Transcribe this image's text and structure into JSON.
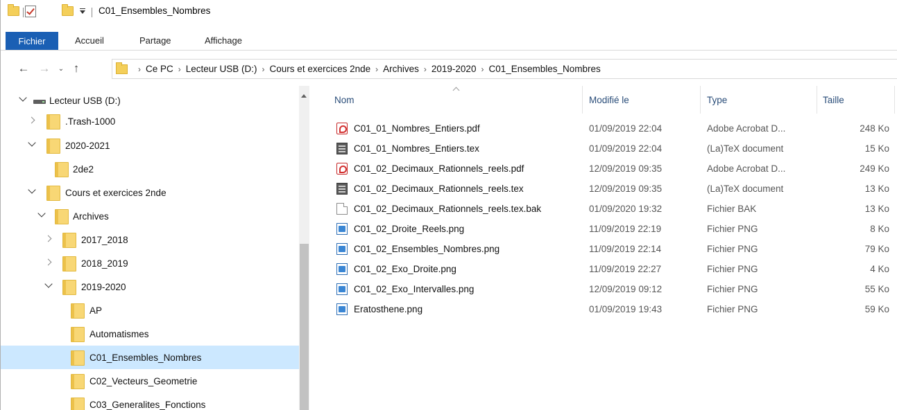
{
  "window": {
    "title": "C01_Ensembles_Nombres"
  },
  "ribbon": {
    "file_tab": "Fichier",
    "tabs": [
      "Accueil",
      "Partage",
      "Affichage"
    ]
  },
  "address": {
    "crumbs": [
      "Ce PC",
      "Lecteur USB (D:)",
      "Cours et exercices 2nde",
      "Archives",
      "2019-2020",
      "C01_Ensembles_Nombres"
    ]
  },
  "navpane": {
    "items": [
      {
        "label": "Lecteur USB (D:)",
        "icon": "usb-drive-icon",
        "state": "expanded"
      },
      {
        "label": ".Trash-1000",
        "icon": "folder-icon",
        "state": "collapsed"
      },
      {
        "label": "2020-2021",
        "icon": "folder-icon",
        "state": "expanded"
      },
      {
        "label": "2de2",
        "icon": "folder-icon",
        "state": "leaf"
      },
      {
        "label": "Cours et exercices 2nde",
        "icon": "folder-icon",
        "state": "expanded"
      },
      {
        "label": "Archives",
        "icon": "folder-icon",
        "state": "expanded"
      },
      {
        "label": "2017_2018",
        "icon": "folder-icon",
        "state": "collapsed"
      },
      {
        "label": "2018_2019",
        "icon": "folder-icon",
        "state": "collapsed"
      },
      {
        "label": "2019-2020",
        "icon": "folder-icon",
        "state": "expanded"
      },
      {
        "label": "AP",
        "icon": "folder-icon",
        "state": "leaf"
      },
      {
        "label": "Automatismes",
        "icon": "folder-icon",
        "state": "leaf"
      },
      {
        "label": "C01_Ensembles_Nombres",
        "icon": "folder-icon",
        "state": "leaf",
        "selected": true
      },
      {
        "label": "C02_Vecteurs_Geometrie",
        "icon": "folder-icon",
        "state": "leaf"
      },
      {
        "label": "C03_Generalites_Fonctions",
        "icon": "folder-icon",
        "state": "leaf"
      }
    ]
  },
  "filelist": {
    "columns": {
      "name": "Nom",
      "modified": "Modifié le",
      "type": "Type",
      "size": "Taille"
    },
    "files": [
      {
        "name": "C01_01_Nombres_Entiers.pdf",
        "modified": "01/09/2019 22:04",
        "type": "Adobe Acrobat D...",
        "size": "248 Ko",
        "icon": "pdf-icon"
      },
      {
        "name": "C01_01_Nombres_Entiers.tex",
        "modified": "01/09/2019 22:04",
        "type": "(La)TeX document",
        "size": "15 Ko",
        "icon": "tex-icon"
      },
      {
        "name": "C01_02_Decimaux_Rationnels_reels.pdf",
        "modified": "12/09/2019 09:35",
        "type": "Adobe Acrobat D...",
        "size": "249 Ko",
        "icon": "pdf-icon"
      },
      {
        "name": "C01_02_Decimaux_Rationnels_reels.tex",
        "modified": "12/09/2019 09:35",
        "type": "(La)TeX document",
        "size": "13 Ko",
        "icon": "tex-icon"
      },
      {
        "name": "C01_02_Decimaux_Rationnels_reels.tex.bak",
        "modified": "01/09/2020 19:32",
        "type": "Fichier BAK",
        "size": "13 Ko",
        "icon": "bak-file-icon"
      },
      {
        "name": "C01_02_Droite_Reels.png",
        "modified": "11/09/2019 22:19",
        "type": "Fichier PNG",
        "size": "8 Ko",
        "icon": "png-icon"
      },
      {
        "name": "C01_02_Ensembles_Nombres.png",
        "modified": "11/09/2019 22:14",
        "type": "Fichier PNG",
        "size": "79 Ko",
        "icon": "png-icon"
      },
      {
        "name": "C01_02_Exo_Droite.png",
        "modified": "11/09/2019 22:27",
        "type": "Fichier PNG",
        "size": "4 Ko",
        "icon": "png-icon"
      },
      {
        "name": "C01_02_Exo_Intervalles.png",
        "modified": "12/09/2019 09:12",
        "type": "Fichier PNG",
        "size": "55 Ko",
        "icon": "png-icon"
      },
      {
        "name": "Eratosthene.png",
        "modified": "01/09/2019 19:43",
        "type": "Fichier PNG",
        "size": "59 Ko",
        "icon": "png-icon"
      }
    ]
  },
  "colors": {
    "accent": "#1a5fb4",
    "selection": "#cce8ff",
    "folder": "#f8d775"
  }
}
